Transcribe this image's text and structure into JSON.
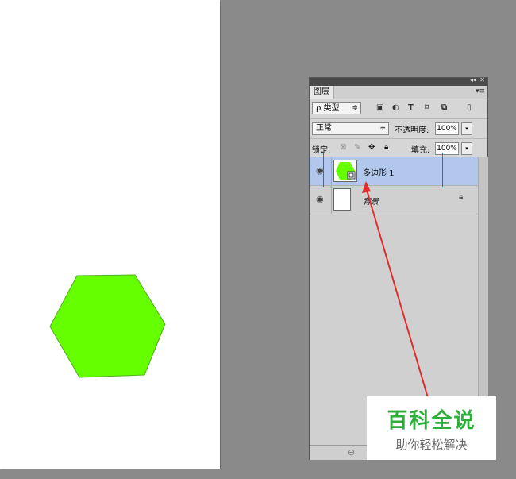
{
  "canvas": {
    "shape_color": "#66ff00"
  },
  "panel": {
    "tab": "图层",
    "menu_icon": "panel-menu-icon",
    "filter": {
      "label": "ρ 类型",
      "icons": [
        "image-filter-icon",
        "adjustment-filter-icon",
        "type-filter-icon",
        "shape-filter-icon",
        "smart-object-filter-icon",
        "filter-toggle-icon"
      ]
    },
    "blend_mode": "正常",
    "opacity_label": "不透明度:",
    "opacity_value": "100%",
    "lock_label": "锁定:",
    "fill_label": "填充:",
    "fill_value": "100%",
    "layers": [
      {
        "name": "多边形 1",
        "selected": true,
        "visible": true
      },
      {
        "name": "背景",
        "selected": false,
        "visible": true,
        "locked": true
      }
    ]
  },
  "watermark": {
    "title": "百科全说",
    "subtitle": "助你轻松解决"
  },
  "annotation": {
    "color": "#e12d2d"
  }
}
